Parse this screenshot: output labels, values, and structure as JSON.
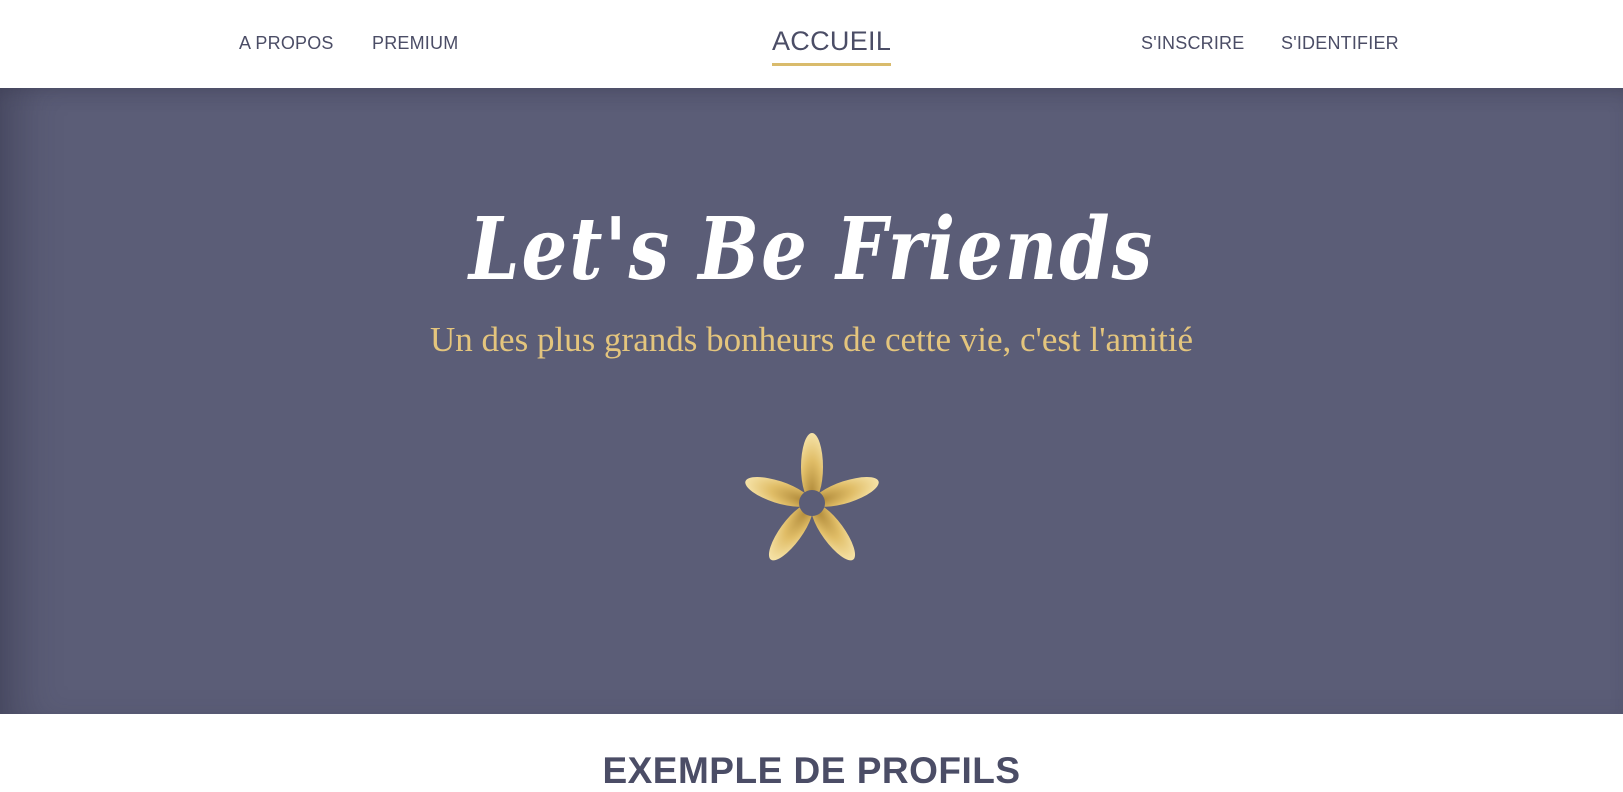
{
  "nav": {
    "left": [
      {
        "label": "A PROPOS"
      },
      {
        "label": "PREMIUM"
      }
    ],
    "center": {
      "label": "ACCUEIL"
    },
    "right": [
      {
        "label": "S'INSCRIRE"
      },
      {
        "label": "S'IDENTIFIER"
      }
    ]
  },
  "hero": {
    "title": "Let's Be Friends",
    "subtitle": "Un des plus grands bonheurs de cette vie, c'est l'amitié",
    "icon": "flower-icon",
    "background_color": "#5b5d77",
    "accent_color": "#e4c57d"
  },
  "section": {
    "title": "EXEMPLE DE PROFILS"
  }
}
